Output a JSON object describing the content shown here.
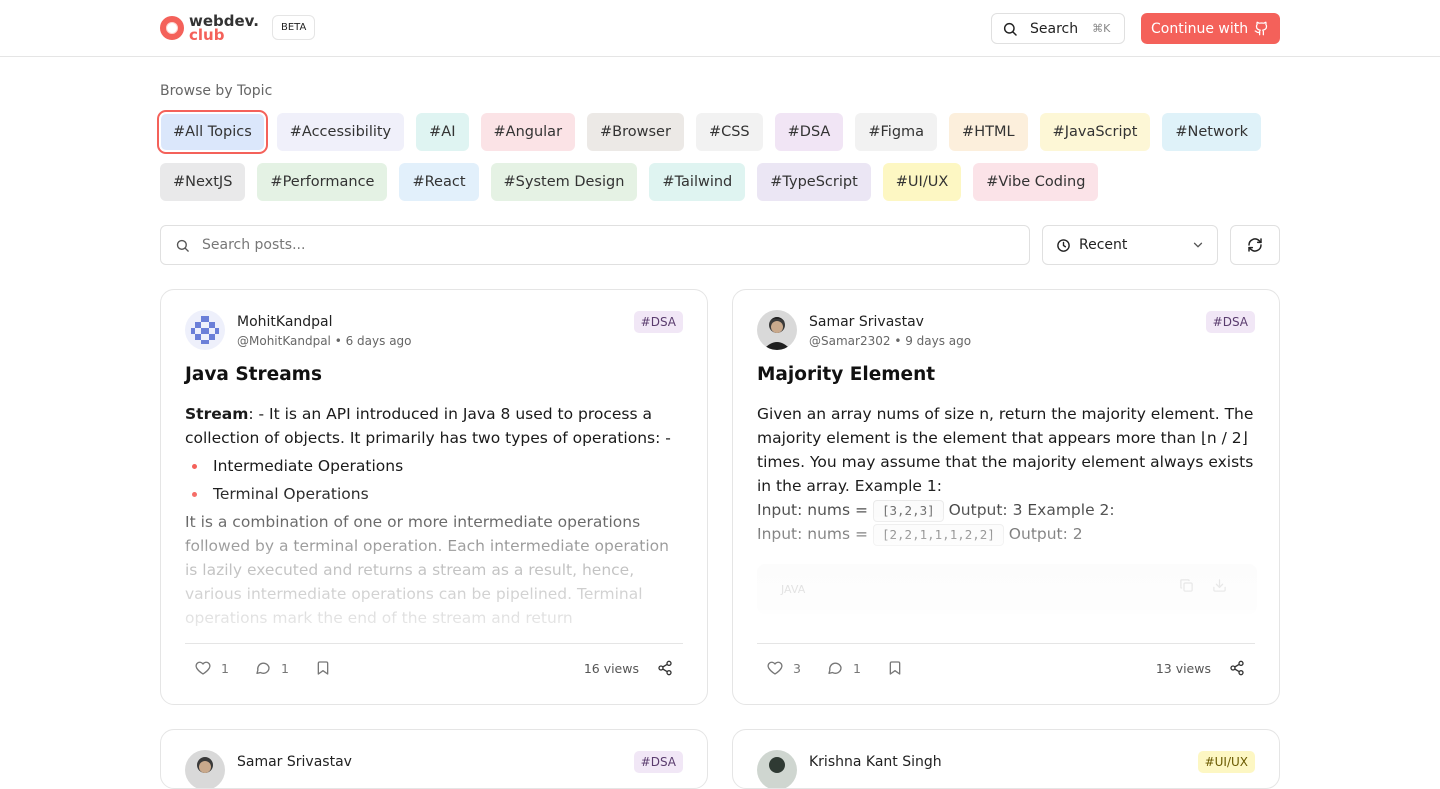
{
  "header": {
    "logo_line1": "webdev.",
    "logo_line2": "club",
    "beta": "BETA",
    "search_label": "Search",
    "search_shortcut": "⌘K",
    "continue_label": "Continue with",
    "accent": "#f4615a"
  },
  "topics": {
    "heading": "Browse by Topic",
    "row1": [
      {
        "label": "#All Topics",
        "bg": "#dbe7fb"
      },
      {
        "label": "#Accessibility",
        "bg": "#f0f0fa"
      },
      {
        "label": "#AI",
        "bg": "#dff4f2"
      },
      {
        "label": "#Angular",
        "bg": "#fbe3e6"
      },
      {
        "label": "#Browser",
        "bg": "#ece9e6"
      },
      {
        "label": "#CSS",
        "bg": "#f2f2f2"
      },
      {
        "label": "#DSA",
        "bg": "#f1e5f5"
      },
      {
        "label": "#Figma",
        "bg": "#f2f2f2"
      },
      {
        "label": "#HTML",
        "bg": "#fcefdc"
      },
      {
        "label": "#JavaScript",
        "bg": "#fdf7d6"
      },
      {
        "label": "#Network",
        "bg": "#dff2f9"
      }
    ],
    "row2": [
      {
        "label": "#NextJS",
        "bg": "#e9e9ea"
      },
      {
        "label": "#Performance",
        "bg": "#e4f2e4"
      },
      {
        "label": "#React",
        "bg": "#e2f0fb"
      },
      {
        "label": "#System Design",
        "bg": "#e5f2e4"
      },
      {
        "label": "#Tailwind",
        "bg": "#dff4f1"
      },
      {
        "label": "#TypeScript",
        "bg": "#ebe6f4"
      },
      {
        "label": "#UI/UX",
        "bg": "#fdf7c3"
      },
      {
        "label": "#Vibe Coding",
        "bg": "#fbe3e8"
      }
    ]
  },
  "filters": {
    "search_placeholder": "Search posts...",
    "sort_value": "Recent"
  },
  "posts": [
    {
      "author": "MohitKandpal",
      "handle": "@MohitKandpal",
      "time": "6 days ago",
      "tag": "#DSA",
      "title": "Java Streams",
      "body": {
        "bold": "Stream",
        "intro": ": - It is an API introduced in Java 8 used to process a collection of objects. It primarily has two types of operations: -",
        "bullets": [
          "Intermediate Operations",
          "Terminal Operations"
        ],
        "after": "It is a combination of one or more intermediate operations followed by a terminal operation. Each intermediate operation is lazily executed and returns a stream as a result, hence, various intermediate operations can be pipelined. Terminal operations mark the end of the stream and return"
      },
      "likes": "1",
      "comments": "1",
      "views": "16 views"
    },
    {
      "author": "Samar Srivastav",
      "handle": "@Samar2302",
      "time": "9 days ago",
      "tag": "#DSA",
      "title": "Majority Element",
      "body": {
        "text": "Given an array nums of size n, return the majority element. The majority element is the element that appears more than ⌊n / 2⌋ times. You may assume that the majority element always exists in the array. Example 1:",
        "line1_pre": "Input: nums =",
        "line1_code": "[3,2,3]",
        "line1_post": "Output: 3 Example 2:",
        "line2_pre": "Input: nums =",
        "line2_code": "[2,2,1,1,1,2,2]",
        "line2_post": "Output: 2",
        "code_lang": "JAVA"
      },
      "likes": "3",
      "comments": "1",
      "views": "13 views"
    },
    {
      "author": "Samar Srivastav",
      "tag": "#DSA"
    },
    {
      "author": "Krishna Kant Singh",
      "tag": "#UI/UX"
    }
  ]
}
